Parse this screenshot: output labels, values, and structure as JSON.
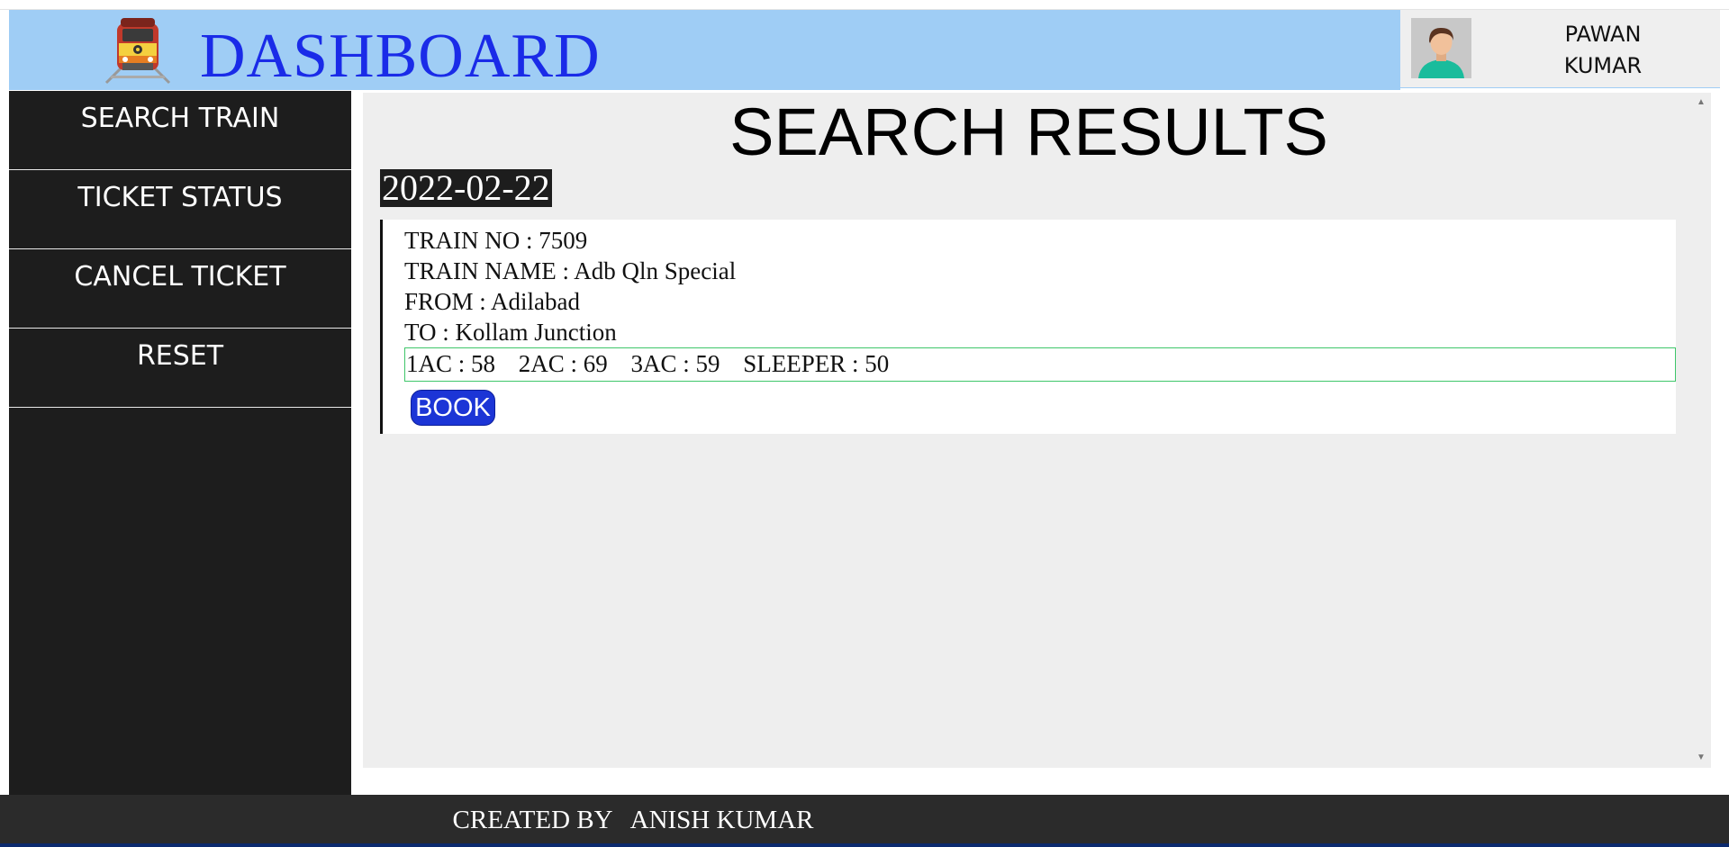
{
  "header": {
    "title": "DASHBOARD",
    "logo_icon": "train-icon",
    "user": {
      "first_name": "PAWAN",
      "last_name": "KUMAR",
      "avatar_icon": "user-avatar-icon"
    }
  },
  "sidebar": {
    "items": [
      {
        "label": "SEARCH TRAIN"
      },
      {
        "label": "TICKET STATUS"
      },
      {
        "label": "CANCEL TICKET"
      },
      {
        "label": "RESET"
      }
    ]
  },
  "main": {
    "title": "SEARCH RESULTS",
    "date": "2022-02-22",
    "results": [
      {
        "train_no": "TRAIN NO : 7509",
        "train_name": "TRAIN NAME : Adb Qln Special",
        "from": "FROM : Adilabad",
        "to": "TO : Kollam Junction",
        "seats": {
          "ac1": "1AC : 58",
          "ac2": "2AC : 69",
          "ac3": "3AC : 59",
          "sleeper": "SLEEPER : 50"
        },
        "book_label": "BOOK"
      }
    ]
  },
  "footer": {
    "text": "CREATED BY   ANISH KUMAR"
  },
  "colors": {
    "header_bg": "#9fcdf5",
    "title_blue": "#1a2be8",
    "sidebar_bg": "#1d1d1d",
    "book_button": "#1c35d6",
    "seat_border": "#3fc66a",
    "footer_bg": "#2b2b2b"
  }
}
